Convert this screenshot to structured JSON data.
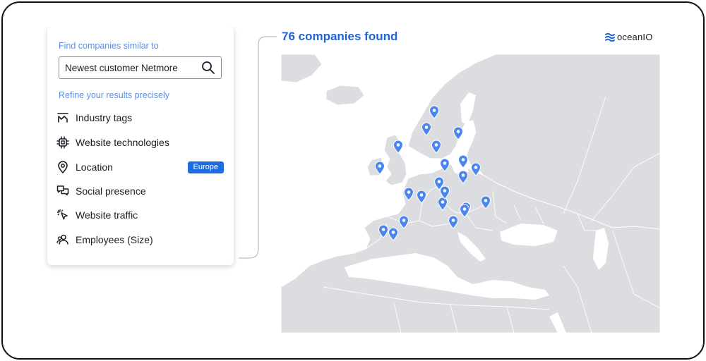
{
  "panel": {
    "find_label": "Find companies similar to",
    "search_value": "Newest customer Netmore",
    "refine_label": "Refine your results precisely",
    "filters": [
      {
        "label": "Industry tags",
        "icon": "industry-tags-icon"
      },
      {
        "label": "Website technologies",
        "icon": "chip-icon"
      },
      {
        "label": "Location",
        "icon": "location-pin-icon",
        "badge": "Europe"
      },
      {
        "label": "Social presence",
        "icon": "chat-bubbles-icon"
      },
      {
        "label": "Website traffic",
        "icon": "cursor-click-icon"
      },
      {
        "label": "Employees (Size)",
        "icon": "users-icon"
      }
    ]
  },
  "results": {
    "title": "76 companies found"
  },
  "logo": {
    "text": "oceanIO"
  },
  "colors": {
    "accent": "#1f63d8",
    "badge": "#1e6be6",
    "pin": "#4b86ee",
    "land": "#dcdde0",
    "label": "#5f8fe0"
  },
  "pin_count": 22
}
